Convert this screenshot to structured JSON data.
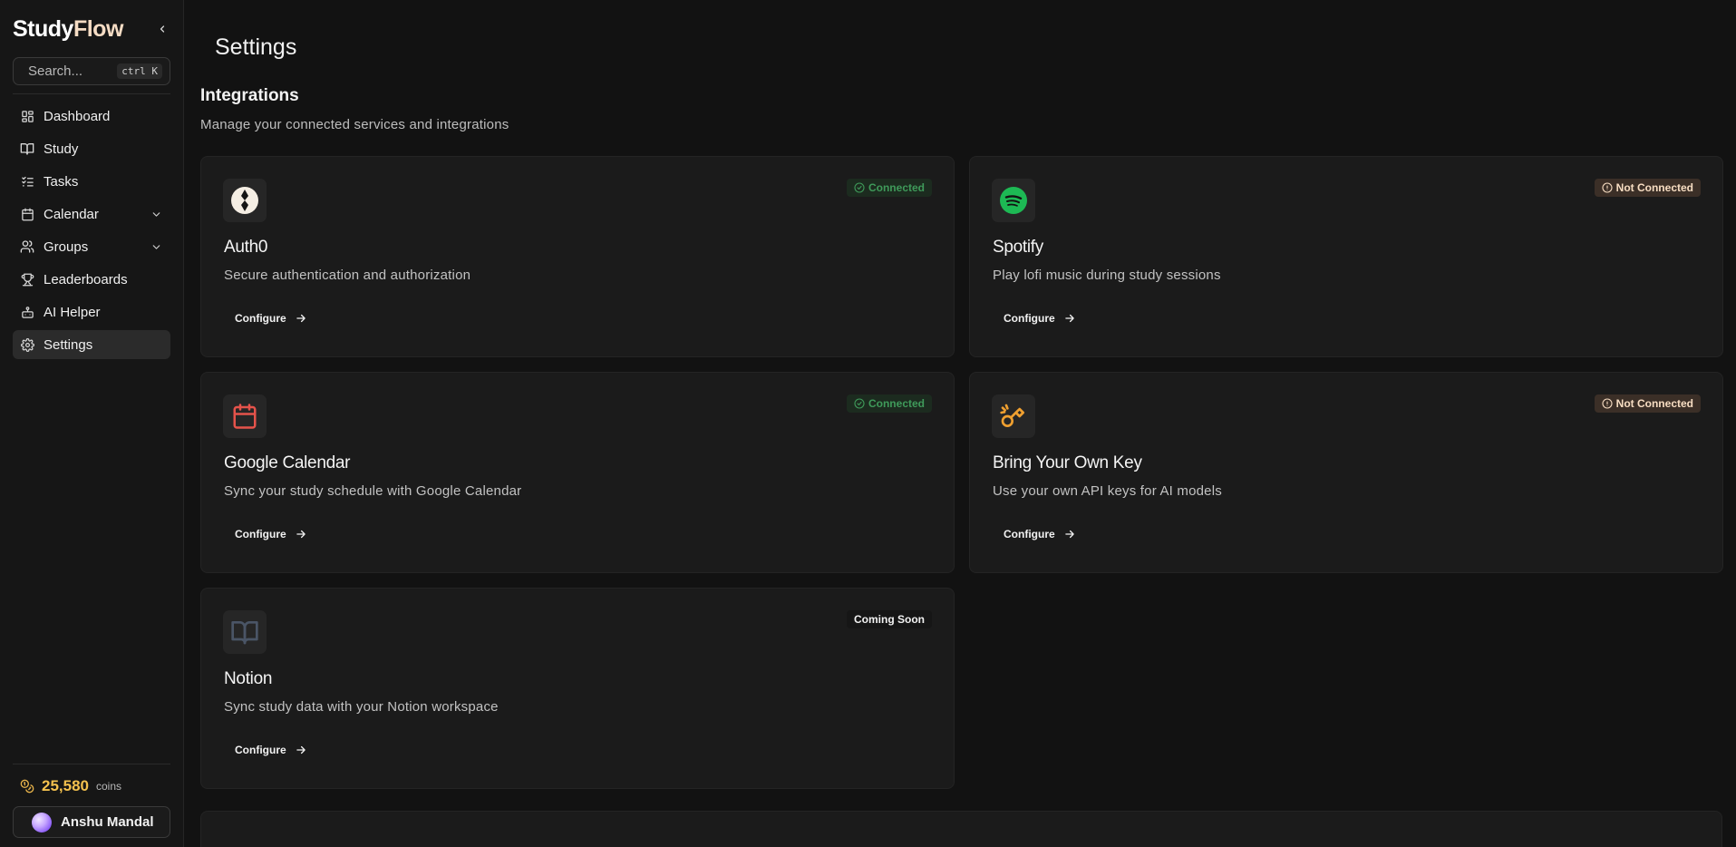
{
  "sidebar": {
    "brand_study": "Study",
    "brand_flow": "Flow",
    "search": {
      "placeholder": "Search...",
      "kbd_ctrl": "ctrl",
      "kbd_key": "K"
    },
    "items": [
      {
        "label": "Dashboard",
        "icon": "dashboard-icon"
      },
      {
        "label": "Study",
        "icon": "book-icon"
      },
      {
        "label": "Tasks",
        "icon": "tasks-icon"
      },
      {
        "label": "Calendar",
        "icon": "calendar-icon"
      },
      {
        "label": "Groups",
        "icon": "users-icon"
      },
      {
        "label": "Leaderboards",
        "icon": "trophy-icon"
      },
      {
        "label": "AI Helper",
        "icon": "bot-icon"
      },
      {
        "label": "Settings",
        "icon": "gear-icon"
      }
    ],
    "coins": {
      "amount": "25,580",
      "unit": "coins"
    },
    "user": {
      "name": "Anshu Mandal"
    }
  },
  "main": {
    "page_title": "Settings",
    "section_title": "Integrations",
    "section_desc": "Manage your connected services and integrations",
    "configure_label": "Configure",
    "cards": [
      {
        "name": "Auth0",
        "desc": "Secure authentication and authorization",
        "status": "Connected"
      },
      {
        "name": "Spotify",
        "desc": "Play lofi music during study sessions",
        "status": "Not Connected"
      },
      {
        "name": "Google Calendar",
        "desc": "Sync your study schedule with Google Calendar",
        "status": "Connected"
      },
      {
        "name": "Bring Your Own Key",
        "desc": "Use your own API keys for AI models",
        "status": "Not Connected"
      },
      {
        "name": "Notion",
        "desc": "Sync study data with your Notion workspace",
        "status": "Coming Soon"
      }
    ]
  },
  "colors": {
    "background": "#121212",
    "card": "#1b1b1b",
    "coins_accent": "#f4c14e",
    "connected": "#3f9a5a",
    "not_connected_bg": "#3b2f27",
    "spotify_green": "#1db954",
    "calendar_red": "#e5534b",
    "key_orange": "#f0a030"
  }
}
